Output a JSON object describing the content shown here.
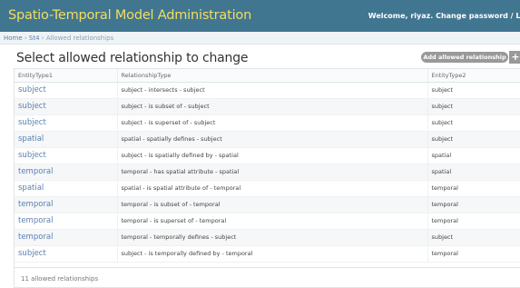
{
  "header": {
    "site_title": "Spatio-Temporal Model Administration",
    "user_tools": "Welcome, riyaz. Change password / Log o"
  },
  "breadcrumbs": {
    "home": "Home",
    "sep1": " › ",
    "app": "St4",
    "sep2": " › ",
    "current": "Allowed relationships"
  },
  "content": {
    "title": "Select allowed relationship to change",
    "add_button": "Add allowed relationship",
    "add_plus": "+"
  },
  "table": {
    "headers": [
      "EntityType1",
      "RelationshipType",
      "EntityType2"
    ],
    "rows": [
      [
        "subject",
        "subject - intersects - subject",
        "subject"
      ],
      [
        "subject",
        "subject - is subset of - subject",
        "subject"
      ],
      [
        "subject",
        "subject - is superset of - subject",
        "subject"
      ],
      [
        "spatial",
        "spatial - spatially defines - subject",
        "subject"
      ],
      [
        "subject",
        "subject - is spatially defined by - spatial",
        "spatial"
      ],
      [
        "temporal",
        "temporal - has spatial attribute - spatial",
        "spatial"
      ],
      [
        "spatial",
        "spatial - is spatial attribute of - temporal",
        "temporal"
      ],
      [
        "temporal",
        "temporal - is subset of - temporal",
        "temporal"
      ],
      [
        "temporal",
        "temporal - is superset of - temporal",
        "temporal"
      ],
      [
        "temporal",
        "temporal - temporally defines - subject",
        "subject"
      ],
      [
        "subject",
        "subject - is temporally defined by - temporal",
        "temporal"
      ]
    ]
  },
  "paginator": "11 allowed relationships",
  "colors": {
    "header_bg": "#417690",
    "title_color": "#f5dd5d",
    "link_color": "#5b80b2"
  }
}
